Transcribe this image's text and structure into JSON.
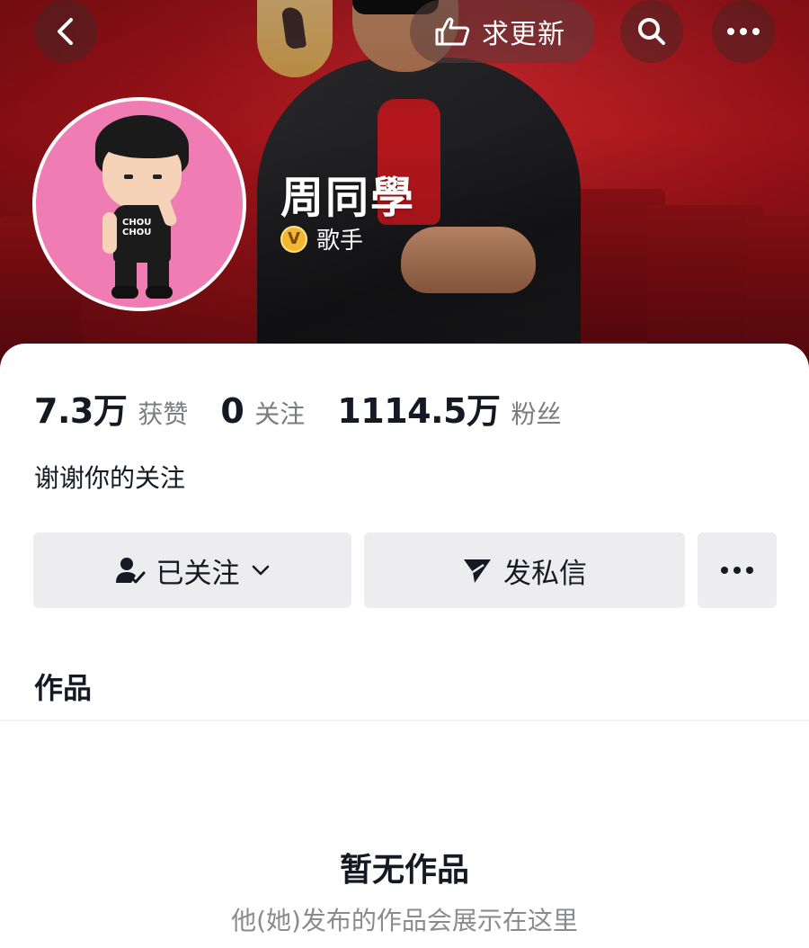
{
  "header": {
    "request_update_label": "求更新",
    "nickname": "周同學",
    "verify_badge": "V",
    "verify_label": "歌手"
  },
  "icons": {
    "back": "chevron-left-icon",
    "request_update": "hand-point-icon",
    "search": "search-icon",
    "more": "more-horizontal-icon",
    "followed": "user-check-icon",
    "dropdown": "chevron-down-icon",
    "message": "send-icon"
  },
  "stats": [
    {
      "value": "7.3万",
      "label": "获赞"
    },
    {
      "value": "0",
      "label": "关注"
    },
    {
      "value": "1114.5万",
      "label": "粉丝"
    }
  ],
  "bio": "谢谢你的关注",
  "actions": {
    "followed_label": "已关注",
    "message_label": "发私信"
  },
  "tabs": {
    "works_label": "作品"
  },
  "empty_state": {
    "title": "暂无作品",
    "subtitle": "他(她)发布的作品会展示在这里"
  },
  "colors": {
    "banner_red": "#9a1217",
    "avatar_pink": "#f07cb4",
    "button_bg": "#ededef",
    "verify_gold": "#f2b632"
  }
}
